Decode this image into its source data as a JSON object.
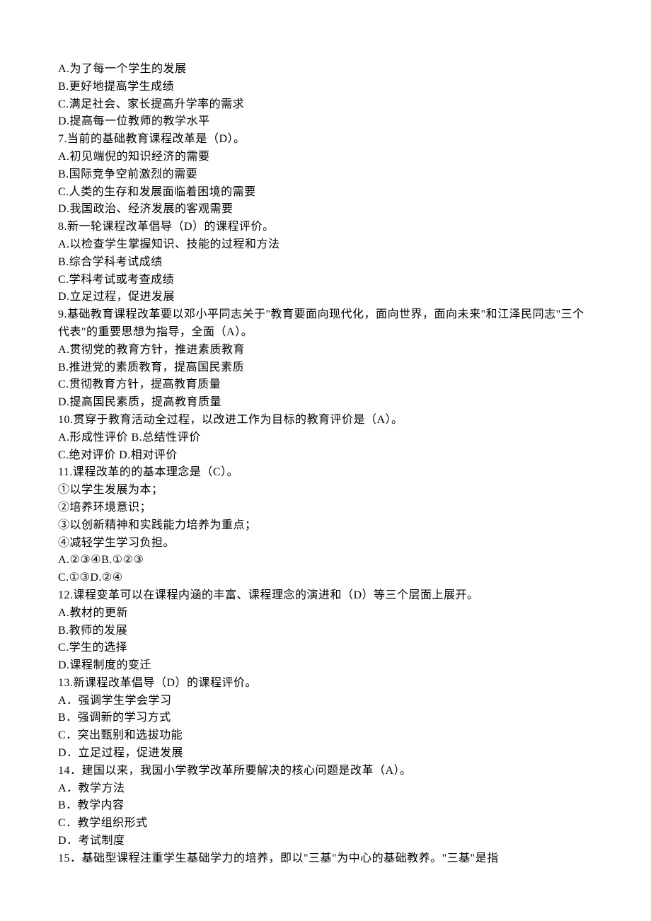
{
  "lines": [
    "A.为了每一个学生的发展",
    "B.更好地提高学生成绩",
    "C.满足社会、家长提高升学率的需求",
    "D.提高每一位教师的教学水平",
    "7.当前的基础教育课程改革是（D）。",
    "A.初见端倪的知识经济的需要",
    "B.国际竞争空前激烈的需要",
    "C.人类的生存和发展面临着困境的需要",
    "D.我国政治、经济发展的客观需要",
    "8.新一轮课程改革倡导（D）的课程评价。",
    "A.以检查学生掌握知识、技能的过程和方法",
    "B.综合学科考试成绩",
    "C.学科考试或考查成绩",
    "D.立足过程，促进发展",
    "9.基础教育课程改革要以邓小平同志关于\"教育要面向现代化，面向世界，面向未来\"和江泽民同志\"三个代表\"的重要思想为指导，全面（A）。",
    "A.贯彻党的教育方针，推进素质教育",
    "B.推进党的素质教育，提高国民素质",
    "C.贯彻教育方针，提高教育质量",
    "D.提高国民素质，提高教育质量",
    "10.贯穿于教育活动全过程，以改进工作为目标的教育评价是（A）。",
    "A.形成性评价 B.总结性评价",
    "C.绝对评价 D.相对评价",
    "11.课程改革的的基本理念是（C）。",
    "①以学生发展为本；",
    "②培养环境意识；",
    "③以创新精神和实践能力培养为重点；",
    "④减轻学生学习负担。",
    "A.②③④B.①②③",
    "C.①③D.②④",
    "12.课程变革可以在课程内涵的丰富、课程理念的演进和（D）等三个层面上展开。",
    "A.教材的更新",
    "B.教师的发展",
    "C.学生的选择",
    "D.课程制度的变迁",
    "13.新课程改革倡导（D）的课程评价。",
    "A．强调学生学会学习",
    "B．强调新的学习方式",
    "C．突出甄别和选拔功能",
    "D．立足过程，促进发展",
    "14．建国以来，我国小学教学改革所要解决的核心问题是改革（A）。",
    "A．教学方法",
    "B．教学内容",
    "C．教学组织形式",
    "D．考试制度",
    "15．基础型课程注重学生基础学力的培养，即以\"三基\"为中心的基础教养。\"三基\"是指"
  ]
}
